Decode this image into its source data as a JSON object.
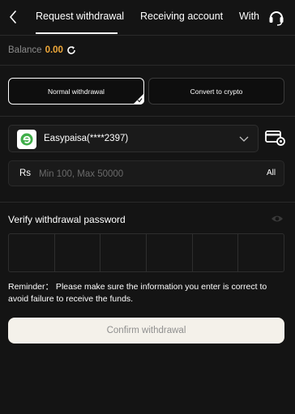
{
  "header": {
    "tabs": [
      {
        "label": "Request withdrawal",
        "active": true
      },
      {
        "label": "Receiving account",
        "active": false
      },
      {
        "label": "With",
        "active": false
      }
    ]
  },
  "balance": {
    "label": "Balance",
    "value": "0.00"
  },
  "methods": [
    {
      "label": "Normal withdrawal",
      "selected": true
    },
    {
      "label": "Convert to crypto",
      "selected": false
    }
  ],
  "account": {
    "name": "Easypaisa(****2397)"
  },
  "amount": {
    "currency": "Rs",
    "placeholder": "Min 100, Max 50000",
    "all_label": "All"
  },
  "password": {
    "label": "Verify withdrawal password",
    "length": 6
  },
  "reminder": "Reminder： Please make sure the information you enter is correct to avoid failure to receive the funds.",
  "confirm_label": "Confirm withdrawal",
  "colors": {
    "background": "#141414",
    "accent": "#f0a93a",
    "confirm_bg": "#f4f1ea",
    "easypaisa_green": "#3fae49"
  },
  "icons": [
    "back-arrow-icon",
    "headset-icon",
    "refresh-icon",
    "check-icon",
    "easypaisa-logo-icon",
    "chevron-down-icon",
    "card-settings-icon",
    "eye-icon"
  ]
}
